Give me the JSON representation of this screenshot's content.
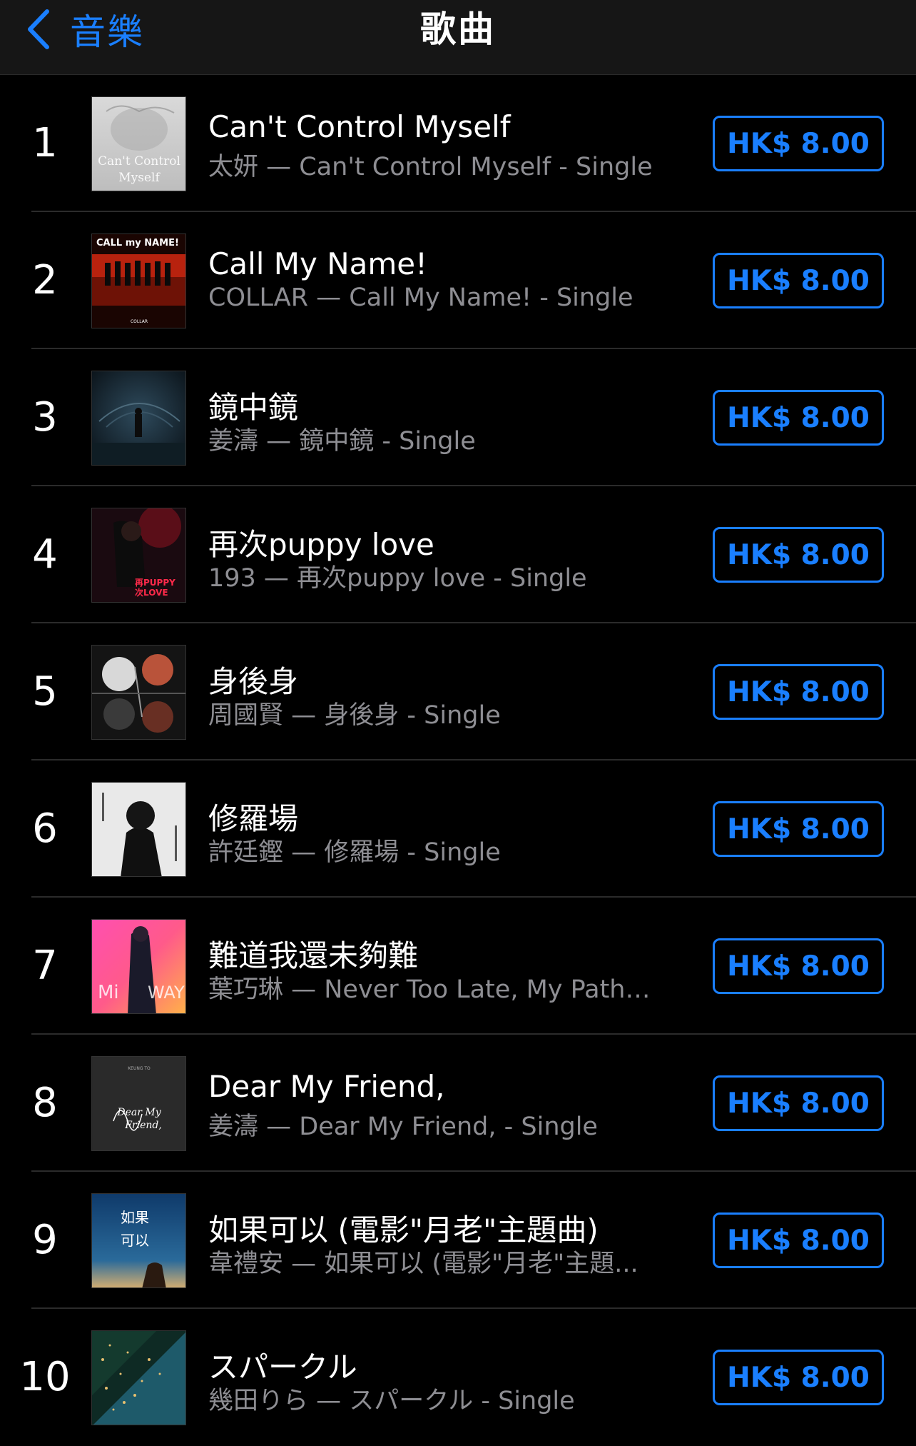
{
  "nav": {
    "back_label": "音樂",
    "title": "歌曲"
  },
  "colors": {
    "accent": "#1a7fff",
    "background": "#000000",
    "navbar": "#161616",
    "secondary_text": "#8e8e93"
  },
  "songs": [
    {
      "rank": "1",
      "title": "Can't Control Myself",
      "subtitle": "太妍 — Can't Control Myself - Single",
      "price": "HK$ 8.00"
    },
    {
      "rank": "2",
      "title": "Call My Name!",
      "subtitle": "COLLAR — Call My Name! - Single",
      "price": "HK$ 8.00"
    },
    {
      "rank": "3",
      "title": "鏡中鏡",
      "subtitle": "姜濤 — 鏡中鏡 - Single",
      "price": "HK$ 8.00"
    },
    {
      "rank": "4",
      "title": "再次puppy love",
      "subtitle": "193 — 再次puppy love - Single",
      "price": "HK$ 8.00"
    },
    {
      "rank": "5",
      "title": "身後身",
      "subtitle": "周國賢 — 身後身 - Single",
      "price": "HK$ 8.00"
    },
    {
      "rank": "6",
      "title": "修羅場",
      "subtitle": "許廷鏗 — 修羅場 - Single",
      "price": "HK$ 8.00"
    },
    {
      "rank": "7",
      "title": "難道我還未夠難",
      "subtitle": "葉巧琳 — Never Too Late, My Path,...",
      "price": "HK$ 8.00"
    },
    {
      "rank": "8",
      "title": "Dear My Friend,",
      "subtitle": "姜濤 — Dear My Friend, - Single",
      "price": "HK$ 8.00"
    },
    {
      "rank": "9",
      "title": "如果可以 (電影\"月老\"主題曲)",
      "subtitle": "韋禮安 — 如果可以 (電影\"月老\"主題...",
      "price": "HK$ 8.00"
    },
    {
      "rank": "10",
      "title": "スパークル",
      "subtitle": "幾田りら — スパークル - Single",
      "price": "HK$ 8.00"
    }
  ],
  "artwork_text": {
    "art1": "Can't Control Myself",
    "art2_top": "CALL my NAME!",
    "art2_bottom": "COLLAR",
    "art4": "再 PUPPY 次 LOVE",
    "art7": "Mi WAY",
    "art8_top": "KEUNG TO",
    "art8_script": "Dear My Friend,",
    "art9": "如果可以"
  }
}
